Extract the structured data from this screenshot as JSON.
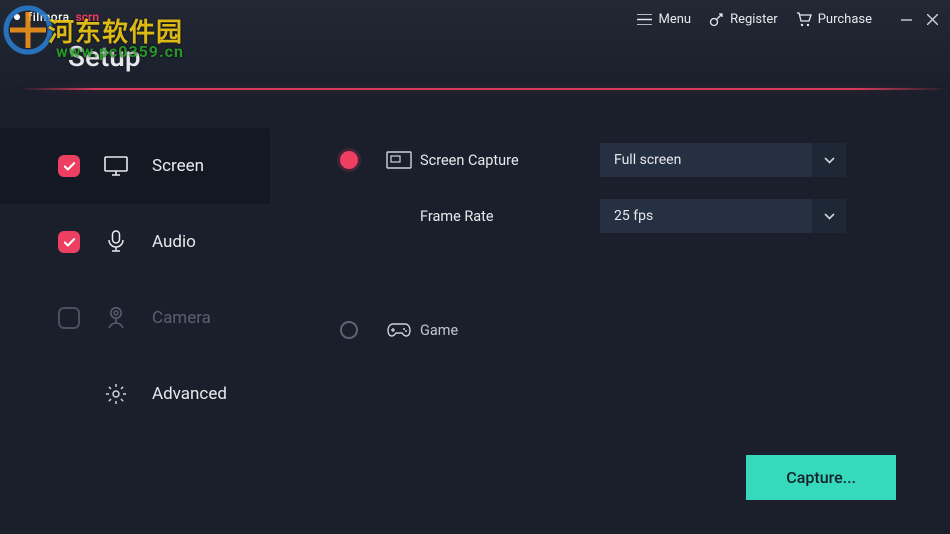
{
  "brand": {
    "main": "filmora",
    "sub": "scrn"
  },
  "title": "Setup",
  "top": {
    "menu": "Menu",
    "register": "Register",
    "purchase": "Purchase"
  },
  "sidebar": {
    "items": [
      {
        "label": "Screen",
        "checked": true,
        "active": true
      },
      {
        "label": "Audio",
        "checked": true,
        "active": false
      },
      {
        "label": "Camera",
        "checked": false,
        "active": false,
        "disabled": true
      },
      {
        "label": "Advanced",
        "active": false
      }
    ]
  },
  "main": {
    "screen_capture": {
      "label": "Screen Capture",
      "value": "Full screen"
    },
    "frame_rate": {
      "label": "Frame Rate",
      "value": "25 fps"
    },
    "game": {
      "label": "Game"
    }
  },
  "capture_button": "Capture...",
  "watermark": {
    "text": "河东软件园",
    "url": "www.pc0359.cn"
  }
}
